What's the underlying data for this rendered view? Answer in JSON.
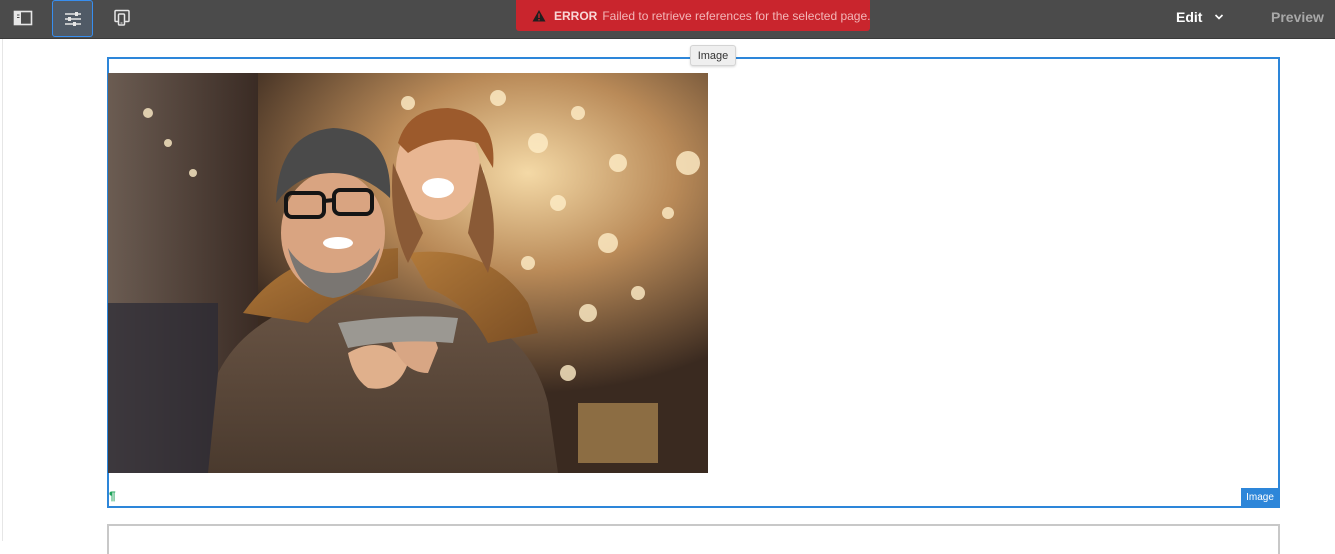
{
  "toolbar": {
    "buttons": [
      {
        "name": "side-panel-toggle",
        "icon": "side-panel-icon"
      },
      {
        "name": "properties",
        "icon": "sliders-icon"
      },
      {
        "name": "emulator",
        "icon": "device-icon"
      }
    ],
    "error": {
      "label": "ERROR",
      "message": "Failed to retrieve references for the selected page."
    },
    "mode": {
      "label": "Edit",
      "icon": "chevron-down-icon"
    },
    "preview_label": "Preview"
  },
  "component": {
    "hover_label": "Image",
    "tag_label": "Image",
    "pilcrow": "¶",
    "image_description": "couple-smiling-christmas-lights-photo"
  },
  "colors": {
    "toolbar_bg": "#4b4b4b",
    "error_bg": "#c9252d",
    "accent": "#2d86d9",
    "pilcrow": "#1fa35a"
  }
}
